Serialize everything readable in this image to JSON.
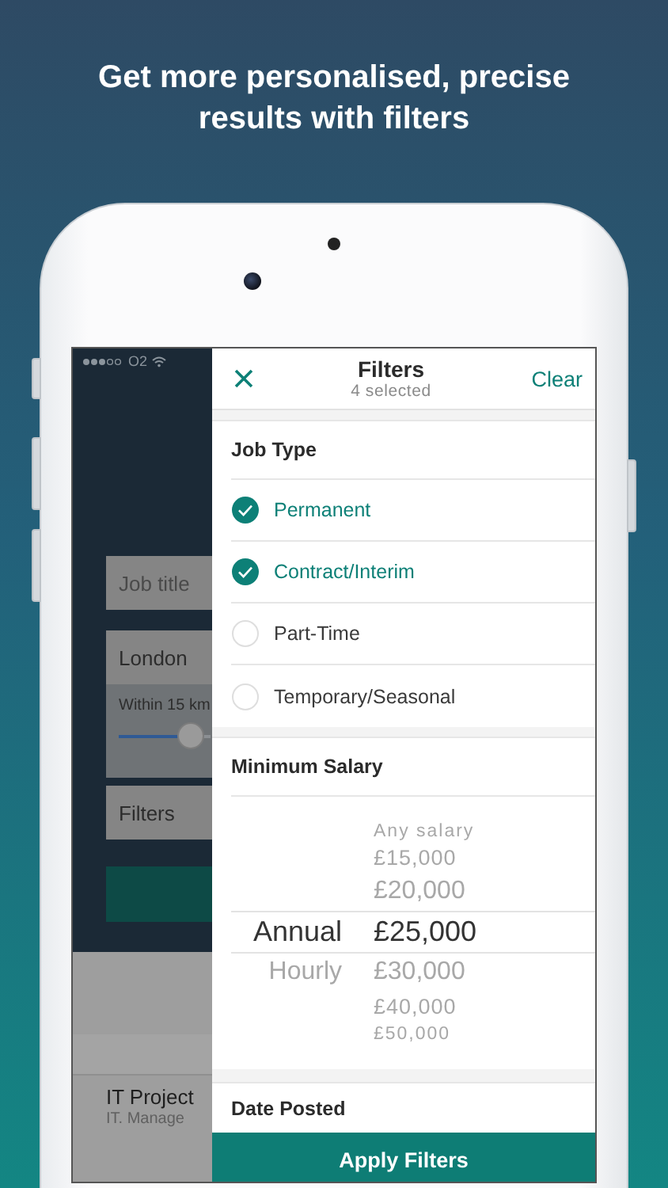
{
  "headline": "Get more personalised, precise results with filters",
  "background_app": {
    "status_bar": {
      "carrier": "O2"
    },
    "keyword_field": {
      "placeholder": "Job title"
    },
    "location_field": {
      "value": "London"
    },
    "radius": {
      "label": "Within 15 km",
      "level": 0.8
    },
    "filters_field": {
      "value": "Filters"
    },
    "results": [
      {
        "title": "IT Project",
        "subtitle": "IT. Manage"
      }
    ]
  },
  "filters": {
    "title": "Filters",
    "subtitle": "4 selected",
    "clear_label": "Clear",
    "job_type": {
      "heading": "Job Type",
      "options": [
        {
          "label": "Permanent",
          "checked": true
        },
        {
          "label": "Contract/Interim",
          "checked": true
        },
        {
          "label": "Part-Time",
          "checked": false
        },
        {
          "label": "Temporary/Seasonal",
          "checked": false
        }
      ]
    },
    "minimum_salary": {
      "heading": "Minimum Salary",
      "pay_periods": [
        {
          "label": "Annual",
          "selected": true
        },
        {
          "label": "Hourly",
          "selected": false
        }
      ],
      "amounts": [
        {
          "label": "Any salary",
          "selected": false
        },
        {
          "label": "£15,000",
          "selected": false
        },
        {
          "label": "£20,000",
          "selected": false
        },
        {
          "label": "£25,000",
          "selected": true
        },
        {
          "label": "£30,000",
          "selected": false
        },
        {
          "label": "£40,000",
          "selected": false
        },
        {
          "label": "£50,000",
          "selected": false
        }
      ]
    },
    "date_posted": {
      "heading": "Date Posted"
    },
    "apply_label": "Apply Filters"
  }
}
